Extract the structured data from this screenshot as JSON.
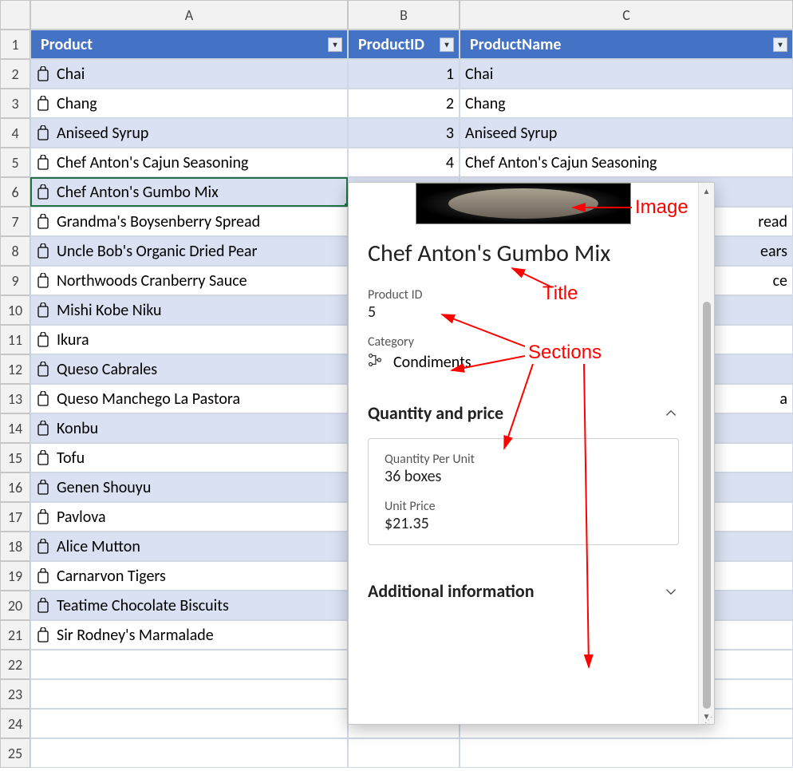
{
  "columns": {
    "A": "A",
    "B": "B",
    "C": "C"
  },
  "header": {
    "product": "Product",
    "productId": "ProductID",
    "productName": "ProductName"
  },
  "rows": [
    {
      "n": 2,
      "product": "Chai",
      "id": "1",
      "name": "Chai"
    },
    {
      "n": 3,
      "product": "Chang",
      "id": "2",
      "name": "Chang"
    },
    {
      "n": 4,
      "product": "Aniseed Syrup",
      "id": "3",
      "name": "Aniseed Syrup"
    },
    {
      "n": 5,
      "product": "Chef Anton's Cajun Seasoning",
      "id": "4",
      "name": "Chef Anton's Cajun Seasoning"
    },
    {
      "n": 6,
      "product": "Chef Anton's Gumbo Mix",
      "id": "",
      "name": ""
    },
    {
      "n": 7,
      "product": "Grandma's Boysenberry Spread",
      "id": "",
      "name": "read"
    },
    {
      "n": 8,
      "product": "Uncle Bob's Organic Dried Pear",
      "id": "",
      "name": "ears"
    },
    {
      "n": 9,
      "product": "Northwoods Cranberry Sauce",
      "id": "",
      "name": "ce"
    },
    {
      "n": 10,
      "product": "Mishi Kobe Niku",
      "id": "",
      "name": ""
    },
    {
      "n": 11,
      "product": "Ikura",
      "id": "",
      "name": ""
    },
    {
      "n": 12,
      "product": "Queso Cabrales",
      "id": "",
      "name": ""
    },
    {
      "n": 13,
      "product": "Queso Manchego La Pastora",
      "id": "",
      "name": "a"
    },
    {
      "n": 14,
      "product": "Konbu",
      "id": "",
      "name": ""
    },
    {
      "n": 15,
      "product": "Tofu",
      "id": "",
      "name": ""
    },
    {
      "n": 16,
      "product": "Genen Shouyu",
      "id": "",
      "name": ""
    },
    {
      "n": 17,
      "product": "Pavlova",
      "id": "",
      "name": ""
    },
    {
      "n": 18,
      "product": "Alice Mutton",
      "id": "",
      "name": ""
    },
    {
      "n": 19,
      "product": "Carnarvon Tigers",
      "id": "",
      "name": ""
    },
    {
      "n": 20,
      "product": "Teatime Chocolate Biscuits",
      "id": "",
      "name": ""
    },
    {
      "n": 21,
      "product": "Sir Rodney's Marmalade",
      "id": "",
      "name": ""
    },
    {
      "n": 22,
      "product": "",
      "id": "",
      "name": ""
    },
    {
      "n": 23,
      "product": "",
      "id": "",
      "name": ""
    },
    {
      "n": 24,
      "product": "",
      "id": "",
      "name": ""
    },
    {
      "n": 25,
      "product": "",
      "id": "",
      "name": ""
    }
  ],
  "card": {
    "title": "Chef Anton's Gumbo Mix",
    "productIdLabel": "Product ID",
    "productIdValue": "5",
    "categoryLabel": "Category",
    "categoryValue": "Condiments",
    "qpHeader": "Quantity and price",
    "qpuLabel": "Quantity Per Unit",
    "qpuValue": "36 boxes",
    "upLabel": "Unit Price",
    "upValue": "$21.35",
    "addlHeader": "Additional information"
  },
  "annot": {
    "image": "Image",
    "title": "Title",
    "sections": "Sections"
  }
}
